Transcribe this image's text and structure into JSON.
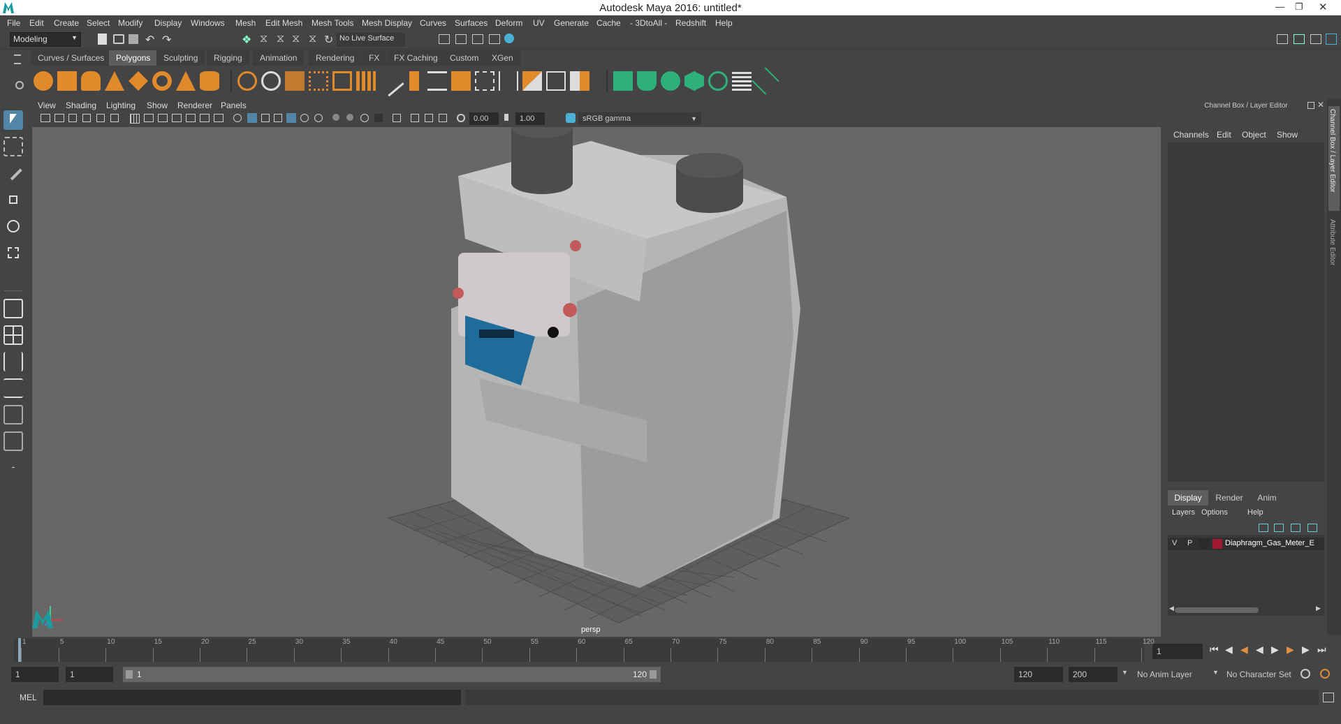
{
  "window": {
    "title": "Autodesk Maya 2016: untitled*"
  },
  "menubar": {
    "items": [
      "File",
      "Edit",
      "Create",
      "Select",
      "Modify",
      "Display",
      "Windows",
      "Mesh",
      "Edit Mesh",
      "Mesh Tools",
      "Mesh Display",
      "Curves",
      "Surfaces",
      "Deform",
      "UV",
      "Generate",
      "Cache",
      "- 3DtoAll -",
      "Redshift",
      "Help"
    ]
  },
  "statusline": {
    "mode": "Modeling",
    "live_surface": "No Live Surface"
  },
  "shelf": {
    "tabs": [
      "Curves / Surfaces",
      "Polygons",
      "Sculpting",
      "Rigging",
      "Animation",
      "Rendering",
      "FX",
      "FX Caching",
      "Custom",
      "XGen"
    ],
    "active_tab": "Polygons"
  },
  "viewport": {
    "menu": [
      "View",
      "Shading",
      "Lighting",
      "Show",
      "Renderer",
      "Panels"
    ],
    "exposure": "0.00",
    "gamma": "1.00",
    "color_space": "sRGB gamma",
    "camera_label": "persp"
  },
  "channelbox": {
    "title": "Channel Box / Layer Editor",
    "menu": [
      "Channels",
      "Edit",
      "Object",
      "Show"
    ],
    "layer_tabs": [
      "Display",
      "Render",
      "Anim"
    ],
    "layer_menu": [
      "Layers",
      "Options",
      "Help"
    ],
    "layer": {
      "v": "V",
      "p": "P",
      "name": "Diaphragm_Gas_Meter_E",
      "color": "#a01830"
    }
  },
  "side_tabs": [
    "Channel Box / Layer Editor",
    "Attribute Editor"
  ],
  "timeline": {
    "ticks": [
      "1",
      "5",
      "10",
      "15",
      "20",
      "25",
      "30",
      "35",
      "40",
      "45",
      "50",
      "55",
      "60",
      "65",
      "70",
      "75",
      "80",
      "85",
      "90",
      "95",
      "100",
      "105",
      "110",
      "115",
      "120"
    ],
    "current_frame": "1"
  },
  "range": {
    "start": "1",
    "start_inner": "1",
    "slider_start": "1",
    "slider_end": "120",
    "end_inner": "120",
    "end": "200",
    "anim_layer": "No Anim Layer",
    "char_set": "No Character Set"
  },
  "command": {
    "lang": "MEL"
  },
  "colors": {
    "accent": "#5285a6",
    "ui_bg": "#444444",
    "viewport_bg": "#676767",
    "orange_icon": "#e08a2c",
    "green_icon": "#2eb07a"
  }
}
